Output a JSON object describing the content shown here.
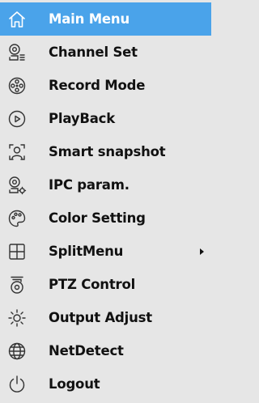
{
  "menu": {
    "items": [
      {
        "label": "Main Menu",
        "icon": "home-icon",
        "active": true
      },
      {
        "label": "Channel Set",
        "icon": "camera-list-icon"
      },
      {
        "label": "Record Mode",
        "icon": "film-reel-icon"
      },
      {
        "label": "PlayBack",
        "icon": "play-circle-icon"
      },
      {
        "label": "Smart snapshot",
        "icon": "face-scan-icon"
      },
      {
        "label": "IPC param.",
        "icon": "camera-settings-icon"
      },
      {
        "label": "Color Setting",
        "icon": "palette-icon"
      },
      {
        "label": "SplitMenu",
        "icon": "grid-split-icon",
        "has_submenu": true
      },
      {
        "label": "PTZ Control",
        "icon": "ptz-camera-icon"
      },
      {
        "label": "Output Adjust",
        "icon": "brightness-icon"
      },
      {
        "label": "NetDetect",
        "icon": "globe-icon"
      },
      {
        "label": "Logout",
        "icon": "power-icon"
      }
    ]
  },
  "colors": {
    "background": "#e6e6e6",
    "highlight": "#4aa3ea",
    "text": "#111111",
    "highlight_text": "#ffffff"
  }
}
